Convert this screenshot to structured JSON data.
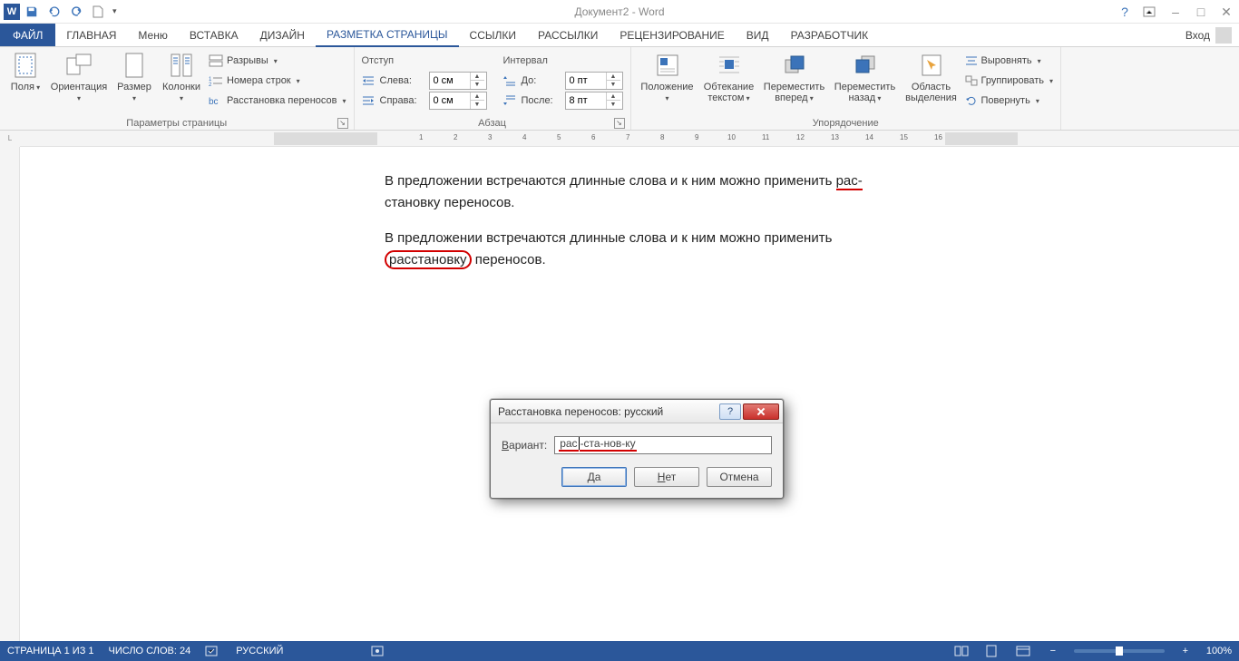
{
  "title": "Документ2 - Word",
  "qat": {
    "save": "save",
    "undo": "undo",
    "redo": "redo",
    "new": "new"
  },
  "win": {
    "help": "?",
    "restore": "restore",
    "min": "–",
    "max": "□",
    "close": "✕"
  },
  "signin_label": "Вход",
  "tabs": {
    "file": "ФАЙЛ",
    "items": [
      "ГЛАВНАЯ",
      "Меню",
      "ВСТАВКА",
      "ДИЗАЙН",
      "РАЗМЕТКА СТРАНИЦЫ",
      "ССЫЛКИ",
      "РАССЫЛКИ",
      "РЕЦЕНЗИРОВАНИЕ",
      "ВИД",
      "РАЗРАБОТЧИК"
    ],
    "active_index": 4
  },
  "ribbon": {
    "page_setup": {
      "label": "Параметры страницы",
      "fields": "Поля",
      "orientation": "Ориентация",
      "size": "Размер",
      "columns": "Колонки",
      "breaks": "Разрывы",
      "line_numbers": "Номера строк",
      "hyphenation": "Расстановка переносов"
    },
    "paragraph": {
      "label": "Абзац",
      "indent_header": "Отступ",
      "spacing_header": "Интервал",
      "left_label": "Слева:",
      "right_label": "Справа:",
      "before_label": "До:",
      "after_label": "После:",
      "left_value": "0 см",
      "right_value": "0 см",
      "before_value": "0 пт",
      "after_value": "8 пт"
    },
    "arrange": {
      "label": "Упорядочение",
      "position": "Положение",
      "wrap": "Обтекание текстом",
      "forward": "Переместить вперед",
      "backward": "Переместить назад",
      "selection_pane": "Область выделения",
      "align": "Выровнять",
      "group": "Группировать",
      "rotate": "Повернуть"
    }
  },
  "ruler_corner": "L",
  "document": {
    "para1_a": "В предложении встречаются длинные слова и к ним можно применить ",
    "para1_b": "рас-",
    "para1_c": "становку переносов.",
    "para2_a": "В предложении встречаются длинные слова и к ним можно применить ",
    "para2_b": "расстановку",
    "para2_c": " переносов."
  },
  "dialog": {
    "title": "Расстановка переносов: русский",
    "variant_label": "Вариант:",
    "variant_value_a": "рас",
    "variant_value_b": "-ста-нов-ку",
    "yes": "Да",
    "no": "Нет",
    "cancel": "Отмена"
  },
  "status": {
    "page": "СТРАНИЦА 1 ИЗ 1",
    "words": "ЧИСЛО СЛОВ: 24",
    "lang": "РУССКИЙ",
    "zoom": "100%"
  }
}
